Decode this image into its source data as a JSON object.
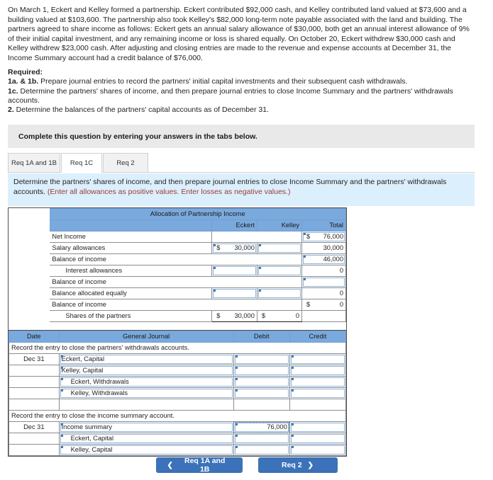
{
  "colors": {
    "header_blue": "#7aa9dd",
    "instruction_blue": "#dbeffc",
    "banner_gray": "#e9e9e9",
    "button_blue": "#3b72b9",
    "note_red": "#9d3b35"
  },
  "problem": {
    "text": "On March 1, Eckert and Kelley formed a partnership. Eckert contributed $92,000 cash, and Kelley contributed land valued at $73,600 and a building valued at $103,600. The partnership also took Kelley's $82,000 long-term note payable associated with the land and building. The partners agreed to share income as follows: Eckert gets an annual salary allowance of $30,000, both get an annual interest allowance of 9% of their initial capital investment, and any remaining income or loss is shared equally. On October 20, Eckert withdrew $30,000 cash and Kelley withdrew $23,000 cash. After adjusting and closing entries are made to the revenue and expense accounts at December 31, the Income Summary account had a credit balance of $76,000."
  },
  "required": {
    "heading": "Required:",
    "items": [
      {
        "num": "1a. & 1b.",
        "text": " Prepare journal entries to record the partners' initial capital investments and their subsequent cash withdrawals."
      },
      {
        "num": "1c.",
        "text": " Determine the partners' shares of income, and then prepare journal entries to close Income Summary and the partners' withdrawals accounts."
      },
      {
        "num": "2.",
        "text": " Determine the balances of the partners' capital accounts as of December 31."
      }
    ]
  },
  "banner": {
    "text": "Complete this question by entering your answers in the tabs below."
  },
  "tabs": [
    {
      "label": "Req 1A and 1B",
      "active": false
    },
    {
      "label": "Req 1C",
      "active": true
    },
    {
      "label": "Req 2",
      "active": false
    }
  ],
  "instruction": {
    "main": "Determine the partners' shares of income, and then prepare journal entries to close Income Summary and the partners' withdrawals accounts. ",
    "note": "(Enter all allowances as positive values. Enter losses as negative values.)"
  },
  "allocation_table": {
    "title": "Allocation of Partnership Income",
    "columns": [
      "",
      "Eckert",
      "Kelley",
      "Total"
    ],
    "rows": [
      {
        "label": "Net Income",
        "indent": false,
        "eckert": "",
        "kelley": "",
        "total": "76,000",
        "total_dollar": "$",
        "eckert_input": false,
        "kelley_input": false,
        "total_input": true
      },
      {
        "label": "Salary allowances",
        "indent": false,
        "eckert": "30,000",
        "kelley": "",
        "total": "30,000",
        "eckert_dollar": "$",
        "eckert_input": true,
        "kelley_input": true,
        "total_input": false
      },
      {
        "label": "Balance of income",
        "indent": false,
        "eckert": "",
        "kelley": "",
        "total": "46,000",
        "span": true,
        "total_input": true
      },
      {
        "label": "Interest allowances",
        "indent": true,
        "eckert": "",
        "kelley": "",
        "total": "0",
        "eckert_input": true,
        "kelley_input": true,
        "total_input": false
      },
      {
        "label": "Balance of income",
        "indent": false,
        "eckert": "",
        "kelley": "",
        "total": "",
        "span": true,
        "total_input": true
      },
      {
        "label": "Balance allocated equally",
        "indent": false,
        "eckert": "",
        "kelley": "",
        "total": "0",
        "eckert_input": true,
        "kelley_input": true,
        "total_input": false
      },
      {
        "label": "Balance of income",
        "indent": false,
        "eckert": "",
        "kelley": "",
        "total": "0",
        "total_dollar": "$",
        "span": true,
        "total_input": false
      },
      {
        "label": "Shares of the partners",
        "indent": true,
        "eckert": "30,000",
        "kelley": "0",
        "total": "",
        "eckert_dollar": "$",
        "kelley_dollar": "$",
        "final": true
      }
    ]
  },
  "journal_table": {
    "columns": [
      "Date",
      "General Journal",
      "Debit",
      "Credit"
    ],
    "sections": [
      {
        "caption": "Record the entry to close the partners' withdrawals accounts.",
        "selected": false,
        "rows": [
          {
            "date": "Dec 31",
            "account": "Eckert, Capital",
            "indent": false,
            "debit": "",
            "credit": ""
          },
          {
            "date": "",
            "account": "Kelley, Capital",
            "indent": false,
            "debit": "",
            "credit": ""
          },
          {
            "date": "",
            "account": "Eckert, Withdrawals",
            "indent": true,
            "debit": "",
            "credit": ""
          },
          {
            "date": "",
            "account": "Kelley, Withdrawals",
            "indent": true,
            "debit": "",
            "credit": ""
          },
          {
            "date": "",
            "account": "",
            "indent": false,
            "debit": "",
            "credit": "",
            "empty": true
          }
        ]
      },
      {
        "caption": "Record the entry to close the income summary account.",
        "selected": true,
        "rows": [
          {
            "date": "Dec 31",
            "account": "Income summary",
            "indent": false,
            "debit": "76,000",
            "credit": "",
            "selected": true
          },
          {
            "date": "",
            "account": "Eckert, Capital",
            "indent": true,
            "debit": "",
            "credit": ""
          },
          {
            "date": "",
            "account": "Kelley, Capital",
            "indent": true,
            "debit": "",
            "credit": ""
          }
        ]
      }
    ]
  },
  "footer": {
    "prev_label": "Req 1A and 1B",
    "prev_chevron": "❮",
    "next_label": "Req 2",
    "next_chevron": "❯"
  }
}
